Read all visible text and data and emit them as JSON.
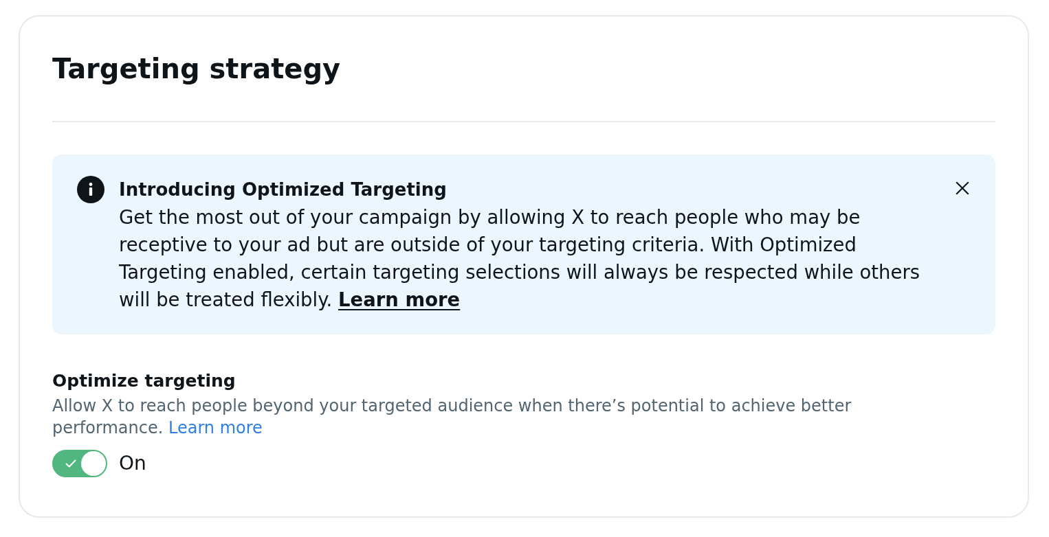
{
  "card": {
    "title": "Targeting strategy"
  },
  "banner": {
    "title": "Introducing Optimized Targeting",
    "body": "Get the most out of your campaign by allowing X to reach people who may be receptive to your ad but are outside of your targeting criteria. With Optimized Targeting enabled, certain targeting selections will always be respected while others will be treated flexibly.",
    "link": "Learn more"
  },
  "setting": {
    "label": "Optimize targeting",
    "description": "Allow X to reach people beyond your targeted audience when there’s potential to achieve better performance.",
    "link": "Learn more",
    "toggle": {
      "on": true,
      "state_label": "On"
    }
  }
}
